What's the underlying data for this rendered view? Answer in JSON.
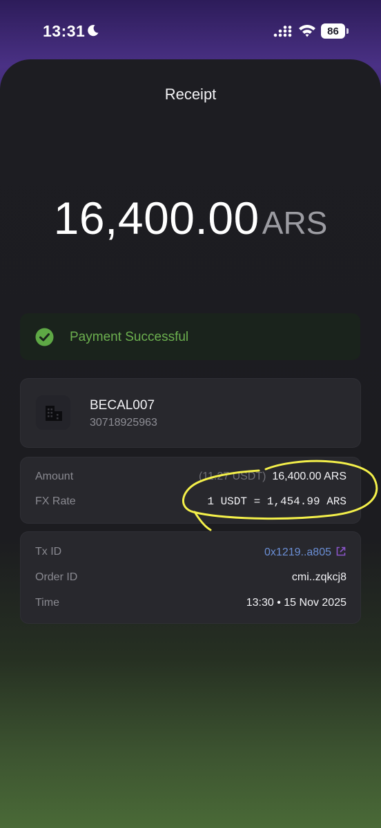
{
  "status_bar": {
    "time": "13:31",
    "battery": "86"
  },
  "header": {
    "title": "Receipt"
  },
  "amount": {
    "value": "16,400.00",
    "currency": "ARS"
  },
  "status": {
    "text": "Payment Successful",
    "color": "#6cb04f"
  },
  "merchant": {
    "name": "BECAL007",
    "id": "30718925963",
    "icon": "building-icon"
  },
  "details": {
    "amount_label": "Amount",
    "amount_usdt": "(11.27 USDT)",
    "amount_value": "16,400.00 ARS",
    "fx_label": "FX Rate",
    "fx_value": "1 USDT = 1,454.99 ARS"
  },
  "transaction": {
    "tx_label": "Tx ID",
    "tx_value": "0x1219..a805",
    "order_label": "Order ID",
    "order_value": "cmi..zqkcj8",
    "time_label": "Time",
    "time_value": "13:30 • 15 Nov 2025"
  },
  "colors": {
    "accent_link": "#6b8fd6",
    "annotation": "#f4f04a"
  }
}
